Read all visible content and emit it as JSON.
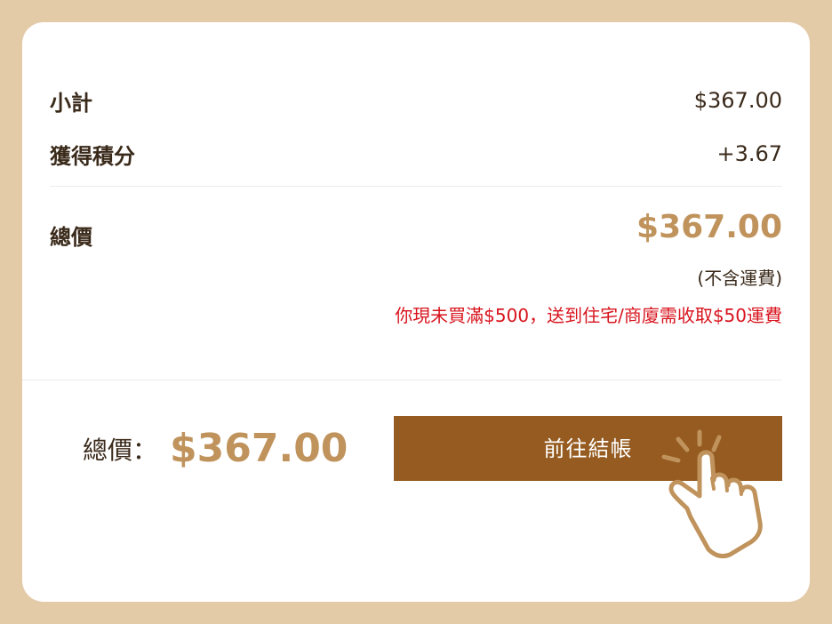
{
  "summary": {
    "subtotal_label": "小計",
    "subtotal_value": "$367.00",
    "points_label": "獲得積分",
    "points_value": "+3.67",
    "total_label": "總價",
    "total_value": "$367.00",
    "shipping_note": "(不含運費)",
    "shipping_warning": "你現未買滿$500，送到住宅/商廈需收取$50運費"
  },
  "footer": {
    "total_label": "總價：",
    "total_value": "$367.00",
    "checkout_label": "前往結帳"
  },
  "icons": {
    "pointer": "hand-pointer-icon"
  },
  "colors": {
    "frame": "#e3cba8",
    "accent": "#c0935c",
    "button": "#955b20",
    "warning": "#d8141d",
    "text": "#3a2a1a"
  }
}
